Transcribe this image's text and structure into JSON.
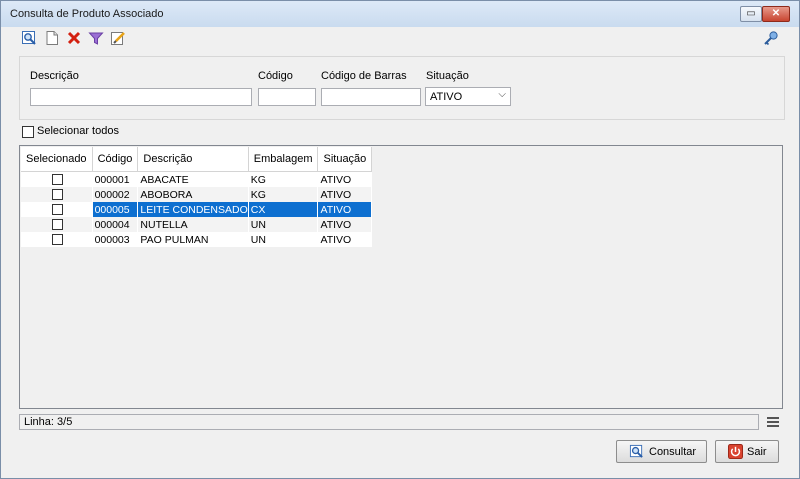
{
  "window": {
    "title": "Consulta de Produto Associado",
    "restore_glyph": "▭",
    "close_glyph": "✕"
  },
  "toolbar": {
    "icons": [
      "search-preview-icon",
      "new-document-icon",
      "delete-icon",
      "filter-icon",
      "edit-icon",
      "key-icon"
    ]
  },
  "filters": {
    "descricao_label": "Descrição",
    "descricao_value": "",
    "codigo_label": "Código",
    "codigo_value": "",
    "codigo_barras_label": "Código de Barras",
    "codigo_barras_value": "",
    "situacao_label": "Situação",
    "situacao_value": "ATIVO",
    "situacao_arrow": "⌵"
  },
  "select_all": {
    "label": "Selecionar todos",
    "checked": false
  },
  "grid": {
    "columns": [
      "Selecionado",
      "Código",
      "Descrição",
      "Embalagem",
      "Situação"
    ],
    "rows": [
      {
        "codigo": "000001",
        "descricao": "ABACATE",
        "embalagem": "KG",
        "situacao": "ATIVO"
      },
      {
        "codigo": "000002",
        "descricao": "ABOBORA",
        "embalagem": "KG",
        "situacao": "ATIVO"
      },
      {
        "codigo": "000005",
        "descricao": "LEITE CONDENSADO",
        "embalagem": "CX",
        "situacao": "ATIVO"
      },
      {
        "codigo": "000004",
        "descricao": "NUTELLA",
        "embalagem": "UN",
        "situacao": "ATIVO"
      },
      {
        "codigo": "000003",
        "descricao": "PAO PULMAN",
        "embalagem": "UN",
        "situacao": "ATIVO"
      }
    ],
    "selected_row": 2
  },
  "status": {
    "text": "Linha: 3/5"
  },
  "buttons": {
    "consultar_label": "Consultar",
    "sair_label": "Sair"
  },
  "colors": {
    "selection": "#0d6fd0",
    "title_bar": "#c9dbef",
    "close_button": "#c84530"
  }
}
